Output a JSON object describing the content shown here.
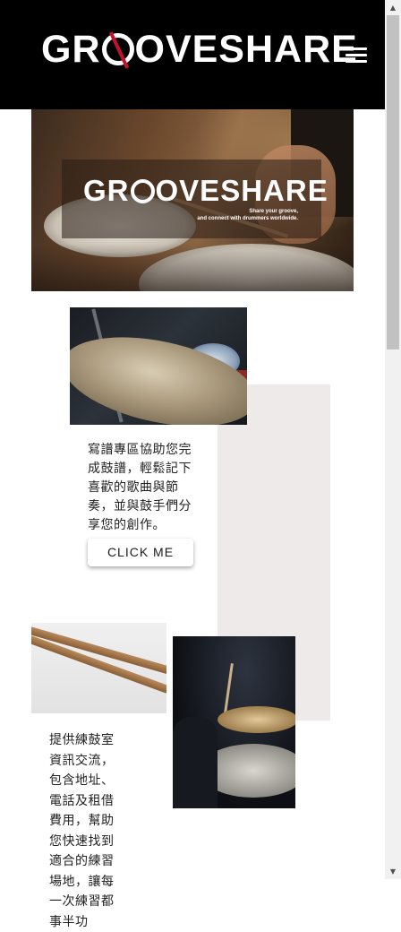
{
  "header": {
    "logo_text_before": "GR",
    "logo_text_after": "OVESHARE",
    "menu_icon": "hamburger-menu-icon"
  },
  "hero": {
    "logo_text_before": "GR",
    "logo_text_after": "OVESHARE",
    "tagline_line1": "Share your groove,",
    "tagline_line2": "and connect with drummers worldwide."
  },
  "section1": {
    "image_alt": "cymbal-image",
    "description": "寫譜專區協助您完成鼓譜，輕鬆記下喜歡的歌曲與節奏，並與鼓手們分享您的創作。",
    "button_label": "CLICK ME"
  },
  "section2": {
    "image1_alt": "drumsticks-image",
    "image2_alt": "drummer-image",
    "description": "提供練鼓室資訊交流，包含地址、電話及租借費用，幫助您快速找到適合的練習場地，讓每一次練習都事半功"
  },
  "colors": {
    "header_bg": "#000000",
    "logo_accent": "#c8102e",
    "panel_grey": "#eeeaea"
  }
}
